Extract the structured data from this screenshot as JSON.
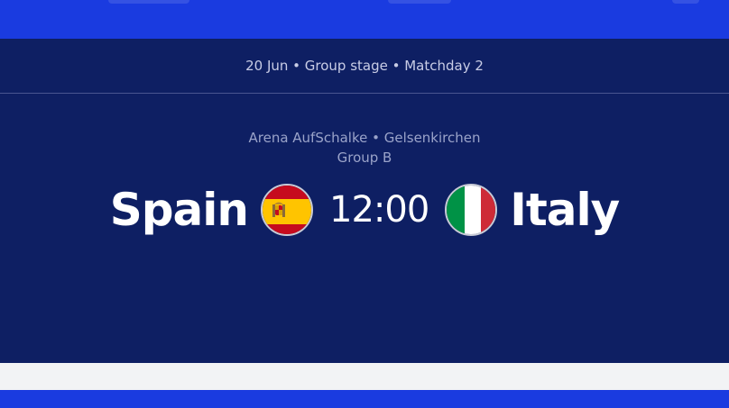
{
  "match": {
    "meta": "20 Jun • Group stage • Matchday 2",
    "venue": "Arena AufSchalke • Gelsenkirchen",
    "group": "Group B",
    "home": {
      "name": "Spain",
      "flag_icon": "spain-flag-icon"
    },
    "kickoff": "12:00",
    "away": {
      "name": "Italy",
      "flag_icon": "italy-flag-icon"
    }
  },
  "colors": {
    "header_blue": "#1a3be0",
    "panel_navy": "#0e1f63",
    "page_background": "#f2f3f5"
  }
}
